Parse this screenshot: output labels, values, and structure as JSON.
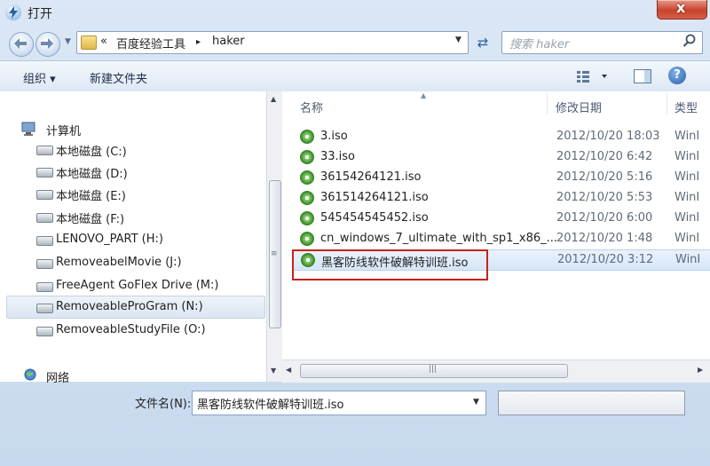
{
  "window": {
    "title": "打开",
    "close_glyph": "x"
  },
  "address": {
    "overflow": "«",
    "crumbs": [
      "百度经验工具",
      "haker"
    ],
    "sep": "▸",
    "dropdown": "▼"
  },
  "search": {
    "placeholder": "搜索 haker"
  },
  "toolbar": {
    "organize": "组织 ▾",
    "new_folder": "新建文件夹"
  },
  "nav": {
    "computer": "计算机",
    "drives": [
      "本地磁盘 (C:)",
      "本地磁盘 (D:)",
      "本地磁盘 (E:)",
      "本地磁盘 (F:)",
      "LENOVO_PART (H:)",
      "RemoveabelMovie (J:)",
      "FreeAgent GoFlex Drive (M:)",
      "RemoveableProGram (N:)",
      "RemoveableStudyFile (O:)"
    ],
    "network": "网络"
  },
  "columns": {
    "name": "名称",
    "date": "修改日期",
    "type": "类型"
  },
  "files": [
    {
      "name": "3.iso",
      "date": "2012/10/20 18:03",
      "type": "WinI"
    },
    {
      "name": "33.iso",
      "date": "2012/10/20 6:42",
      "type": "WinI"
    },
    {
      "name": "36154264121.iso",
      "date": "2012/10/20 5:16",
      "type": "WinI"
    },
    {
      "name": "361514264121.iso",
      "date": "2012/10/20 5:53",
      "type": "WinI"
    },
    {
      "name": "545454545452.iso",
      "date": "2012/10/20 6:00",
      "type": "WinI"
    },
    {
      "name": "cn_windows_7_ultimate_with_sp1_x86_...",
      "date": "2012/10/20 1:48",
      "type": "WinI"
    },
    {
      "name": "黑客防线软件破解特训班.iso",
      "date": "2012/10/20 3:12",
      "type": "WinI"
    }
  ],
  "filename": {
    "label": "文件名(N):",
    "value": "黑客防线软件破解特训班.iso"
  },
  "colors": {
    "highlight": "#c9221b"
  }
}
